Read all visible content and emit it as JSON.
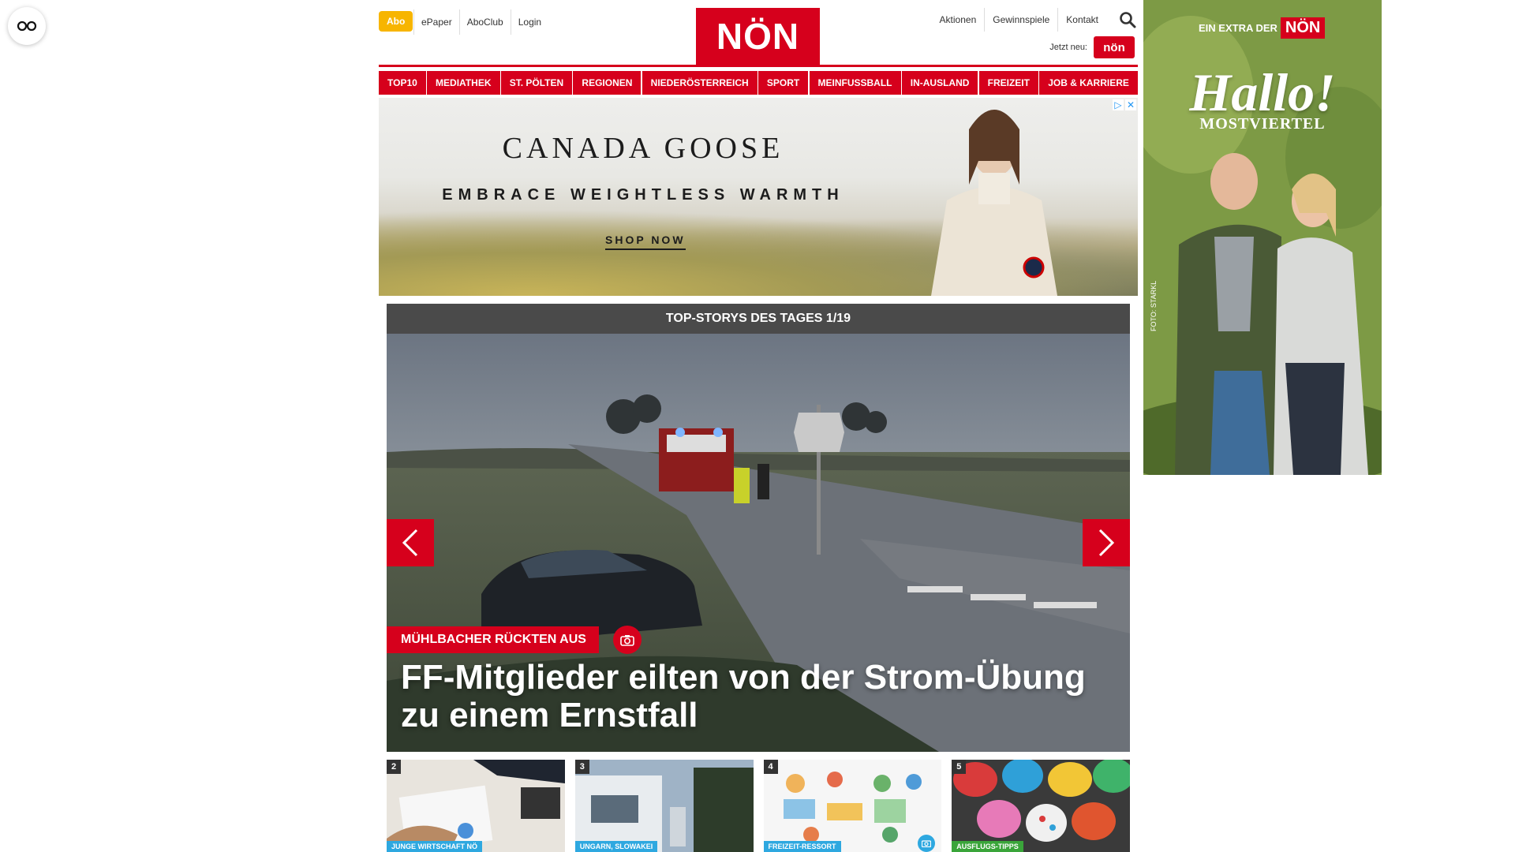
{
  "reader_mode": {
    "icon": "glasses-icon"
  },
  "header": {
    "abo": "Abo",
    "left_links": [
      "ePaper",
      "AboClub",
      "Login"
    ],
    "logo": "NÖN",
    "right_links": [
      "Aktionen",
      "Gewinnspiele",
      "Kontakt"
    ],
    "jetzt_neu": "Jetzt neu:",
    "mini_logo": "nön"
  },
  "nav": [
    "TOP10",
    "MEDIATHEK",
    "ST. PÖLTEN",
    "REGIONEN",
    "NIEDERÖSTERREICH",
    "SPORT",
    "MEINFUSSBALL",
    "IN-AUSLAND",
    "FREIZEIT",
    "JOB & KARRIERE"
  ],
  "ad_banner": {
    "brand": "CANADA GOOSE",
    "tagline": "EMBRACE WEIGHTLESS WARMTH",
    "cta": "SHOP NOW"
  },
  "stories": {
    "heading": "TOP-STORYS DES TAGES 1/19",
    "kicker": "MÜHLBACHER RÜCKTEN AUS",
    "title": "FF-Mitglieder eilten von der Strom-Übung zu einem Ernstfall",
    "thumbs": [
      {
        "num": "2",
        "tag": "JUNGE WIRTSCHAFT NÖ",
        "color": "#2ea8e0"
      },
      {
        "num": "3",
        "tag": "UNGARN, SLOWAKEI",
        "color": "#2ea8e0"
      },
      {
        "num": "4",
        "tag": "FREIZEIT-RESSORT",
        "color": "#2ea8e0"
      },
      {
        "num": "5",
        "tag": "AUSFLUGS-TIPPS",
        "color": "#3aa53a"
      }
    ]
  },
  "sky_ad": {
    "extra_label": "EIN EXTRA DER",
    "logo": "NÖN",
    "headline": "Hallo!",
    "sub": "MOSTVIERTEL",
    "credit": "FOTO: STARKL"
  },
  "colors": {
    "brand_red": "#d6001c",
    "abo_yellow": "#f7b500"
  }
}
